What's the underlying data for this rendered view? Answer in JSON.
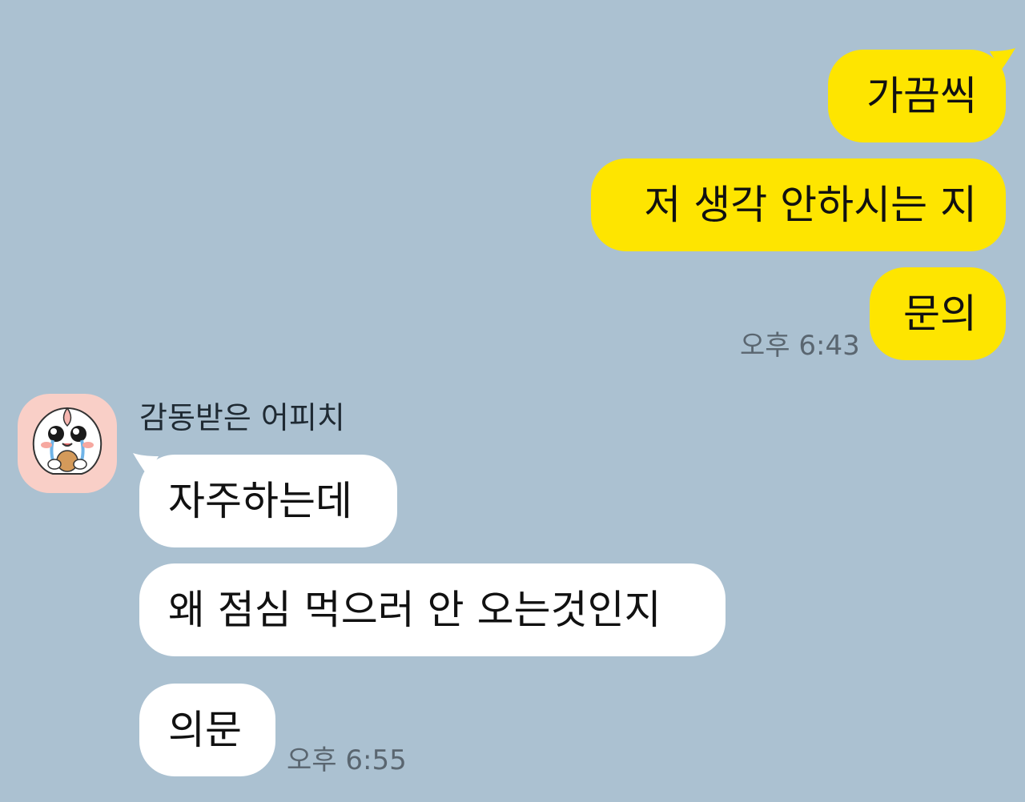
{
  "messages_out": [
    {
      "text": "가끔씩"
    },
    {
      "text": "저 생각 안하시는 지"
    },
    {
      "text": "문의"
    }
  ],
  "time_out": "오후 6:43",
  "sender": {
    "name": "감동받은 어피치",
    "avatar_icon": "crying-peach-avatar-icon"
  },
  "messages_in": [
    {
      "text": "자주하는데"
    },
    {
      "text": "왜 점심 먹으러 안 오는것인지"
    },
    {
      "text": "의문"
    }
  ],
  "time_in": "오후 6:55",
  "colors": {
    "background": "#abc1d1",
    "my_bubble": "#fee500",
    "their_bubble": "#ffffff",
    "timestamp": "#5a6670"
  }
}
